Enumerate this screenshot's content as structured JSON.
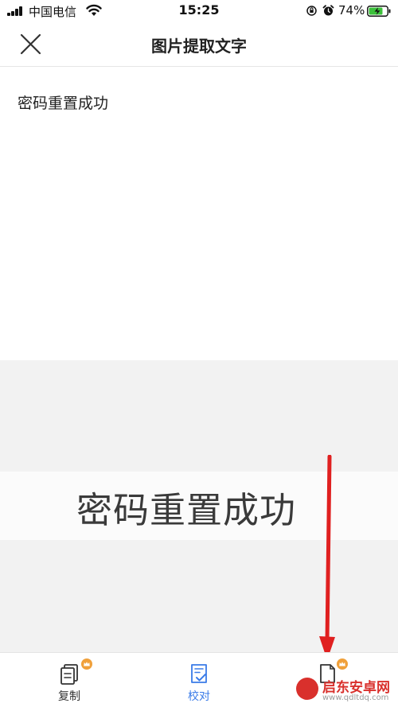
{
  "status_bar": {
    "carrier": "中国电信",
    "time": "15:25",
    "battery_percent": "74%"
  },
  "nav": {
    "title": "图片提取文字"
  },
  "result": {
    "text": "密码重置成功"
  },
  "preview": {
    "image_text": "密码重置成功"
  },
  "toolbar": {
    "copy_label": "复制",
    "proofread_label": "校对",
    "export_icon": "document-export-icon",
    "proofread_active_color": "#3a7be8",
    "vip_badge_color": "#f0a03a"
  },
  "annotation": {
    "arrow_color": "#e02020"
  },
  "watermark": {
    "title": "启东安卓网",
    "url": "www.qdltdq.com"
  }
}
